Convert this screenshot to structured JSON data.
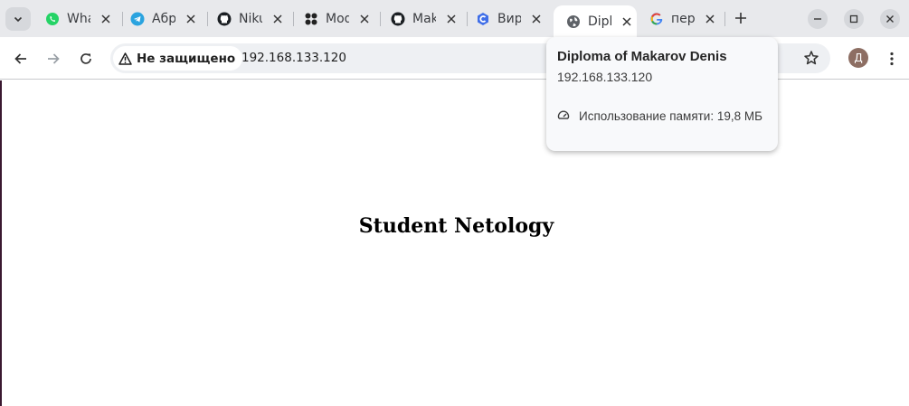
{
  "tabs": [
    {
      "title": "WhatsApp",
      "icon": "whatsapp-icon"
    },
    {
      "title": "Абракадабра",
      "icon": "telegram-icon"
    },
    {
      "title": "Nikulin",
      "icon": "github-icon"
    },
    {
      "title": "Modules",
      "icon": "modules-icon"
    },
    {
      "title": "Makarov",
      "icon": "github-icon"
    },
    {
      "title": "Виртуальные",
      "icon": "cloud-icon"
    },
    {
      "title": "Diploma of Makarov Denis",
      "icon": "globe-icon",
      "active": true
    },
    {
      "title": "перевод",
      "icon": "google-icon"
    }
  ],
  "toolbar": {
    "security_label": "Не защищено",
    "url": "192.168.133.120",
    "profile_initial": "Д"
  },
  "hovercard": {
    "title": "Diploma of Makarov Denis",
    "url": "192.168.133.120",
    "memory": "Использование памяти: 19,8 МБ"
  },
  "page": {
    "heading": "Student Netology"
  },
  "colors": {
    "tabstrip": "#e8e9ec",
    "omnibox": "#eef0f3",
    "avatar": "#8d6e63"
  }
}
